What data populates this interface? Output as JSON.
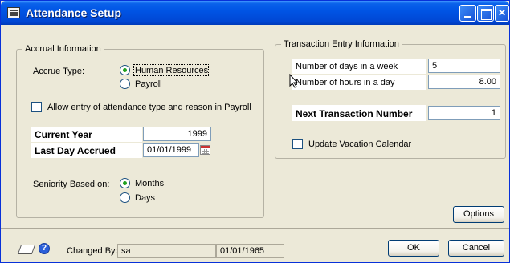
{
  "window": {
    "title": "Attendance Setup"
  },
  "accrual": {
    "group_title": "Accrual Information",
    "accrue_type_label": "Accrue Type:",
    "accrue_options": [
      "Human Resources",
      "Payroll"
    ],
    "accrue_selected": "Human Resources",
    "allow_entry_label": "Allow entry of attendance type and reason in Payroll",
    "allow_entry_checked": false,
    "current_year_label": "Current Year",
    "current_year_value": "1999",
    "last_day_label": "Last Day Accrued",
    "last_day_value": "01/01/1999",
    "seniority_label": "Seniority Based on:",
    "seniority_options": [
      "Months",
      "Days"
    ],
    "seniority_selected": "Months"
  },
  "transaction": {
    "group_title": "Transaction Entry Information",
    "days_week_label": "Number of days in a week",
    "days_week_value": "5",
    "hours_day_label": "Number of hours in a day",
    "hours_day_value": "8.00",
    "next_txn_label": "Next Transaction Number",
    "next_txn_value": "1",
    "update_vacation_label": "Update Vacation Calendar",
    "update_vacation_checked": false
  },
  "buttons": {
    "options": "Options",
    "ok": "OK",
    "cancel": "Cancel"
  },
  "footer": {
    "changed_by_label": "Changed By:",
    "changed_by_user": "sa",
    "changed_by_date": "01/01/1965"
  },
  "icons": [
    "window-icon",
    "note-icon",
    "help-icon",
    "calendar-icon",
    "mouse-cursor-icon"
  ]
}
